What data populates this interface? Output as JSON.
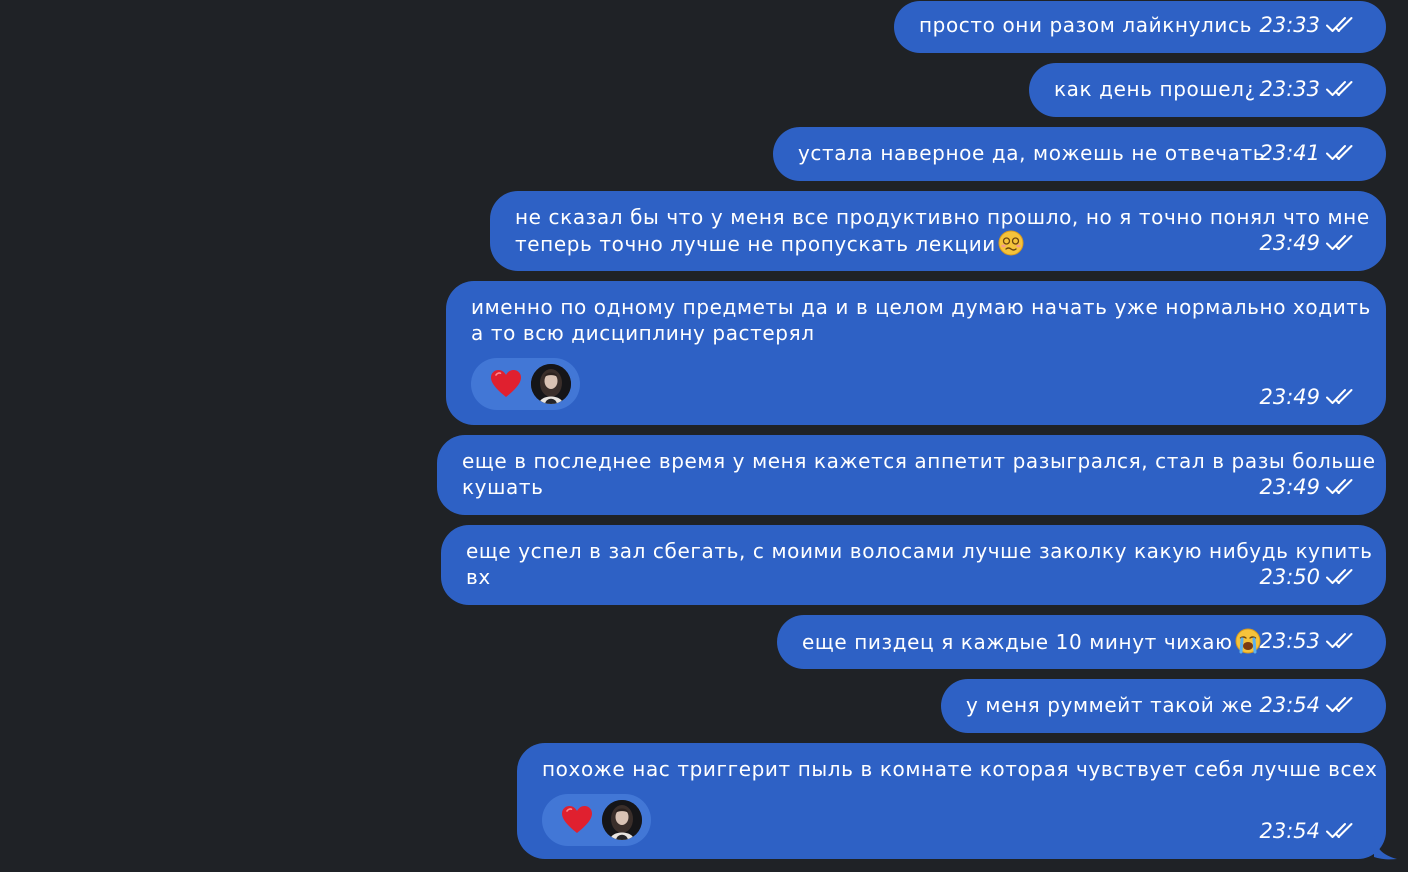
{
  "colors": {
    "background": "#1f2226",
    "outgoing_bubble": "#2e61c5",
    "reaction_pill": "#4277d6",
    "text": "#ffffff"
  },
  "messages": [
    {
      "text": "просто они разом лайкнулись",
      "time": "23:33",
      "status": "read-double-check"
    },
    {
      "text": "как день прошел¿",
      "time": "23:33",
      "status": "read-double-check"
    },
    {
      "text": "устала наверное да, можешь не отвечать",
      "time": "23:41",
      "status": "read-double-check"
    },
    {
      "line1": "не сказал бы что у меня все продуктивно прошло, но я точно понял что мне",
      "line2": "теперь точно лучше не пропускать лекции",
      "emoji": "woozy-face-emoji",
      "time": "23:49",
      "status": "read-double-check"
    },
    {
      "line1": "именно по одному предметы да и в целом думаю начать уже нормально ходить",
      "line2": "а то всю дисциплину растерял",
      "reaction": "heart-emoji",
      "time": "23:49",
      "status": "read-double-check"
    },
    {
      "line1": "еще в последнее время у меня кажется аппетит разыгрался, стал в разы больше",
      "line2": "кушать",
      "time": "23:49",
      "status": "read-double-check"
    },
    {
      "line1": "еще успел в зал сбегать, с моими волосами лучше заколку какую нибудь купить",
      "line2": "вх",
      "time": "23:50",
      "status": "read-double-check"
    },
    {
      "text": "еще пиздец я каждые 10 минут чихаю",
      "emoji": "loudly-crying-face-emoji",
      "time": "23:53",
      "status": "read-double-check"
    },
    {
      "text": "у меня руммейт такой же",
      "time": "23:54",
      "status": "read-double-check"
    },
    {
      "text": "похоже нас триггерит пыль в комнате которая чувствует себя лучше всех",
      "reaction": "heart-emoji",
      "time": "23:54",
      "status": "read-double-check"
    }
  ]
}
